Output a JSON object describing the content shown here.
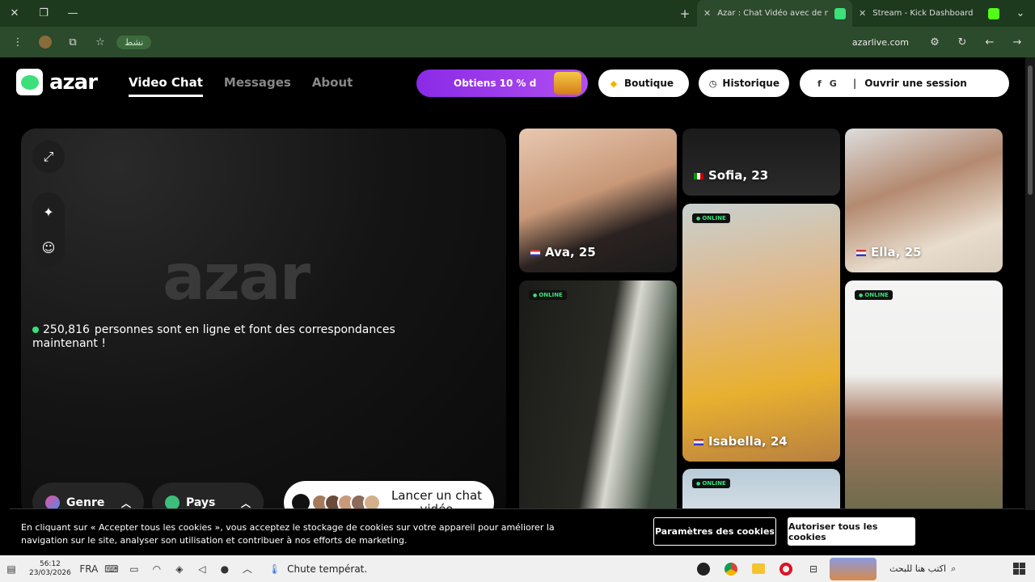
{
  "browser": {
    "tabs": [
      {
        "title": "Azar : Chat Vidéo avec de nouv",
        "active": true,
        "favicon_color": "#3be07a"
      },
      {
        "title": "Stream - Kick Dashboard",
        "active": false,
        "favicon_color": "#53fc18"
      }
    ],
    "new_tab_symbol": "+",
    "url": "azarlive.com",
    "extension_label": "نشط"
  },
  "site": {
    "logo": "azar",
    "nav": [
      {
        "label": "Video Chat",
        "active": true
      },
      {
        "label": "Messages",
        "active": false
      },
      {
        "label": "About",
        "active": false
      }
    ],
    "promo_label": "Obtiens 10 % d",
    "boutique_label": "Boutique",
    "historique_label": "Historique",
    "login_label": "Ouvrir une session",
    "login_social": [
      "",
      "f",
      "G",
      ""
    ]
  },
  "panel": {
    "watermark": "azar",
    "online_count": "250,816",
    "online_text": "personnes sont en ligne et font des correspondances maintenant !",
    "genre_label": "Genre",
    "pays_label": "Pays",
    "launch_label": "Lancer un chat vidéo"
  },
  "profiles": [
    {
      "name": "Ava, 25",
      "flag": "us"
    },
    {
      "name": "Sofia, 23",
      "flag": "it"
    },
    {
      "name": "Ella, 25",
      "flag": "us"
    },
    {
      "name": "Isabella, 24",
      "flag": "us"
    }
  ],
  "online_badge": "ONLINE",
  "cookie": {
    "text": "En cliquant sur « Accepter tous les cookies », vous acceptez le stockage de cookies sur votre appareil pour améliorer la navigation sur le site, analyser son utilisation et contribuer à nos efforts de marketing.",
    "params_label": "Paramètres des cookies",
    "accept_label": "Autoriser tous les cookies"
  },
  "taskbar": {
    "time": "56:12",
    "date": "23/03/2026",
    "lang": "FRA",
    "weather": "Chute températ.",
    "search_placeholder": "اكتب هنا للبحث"
  }
}
